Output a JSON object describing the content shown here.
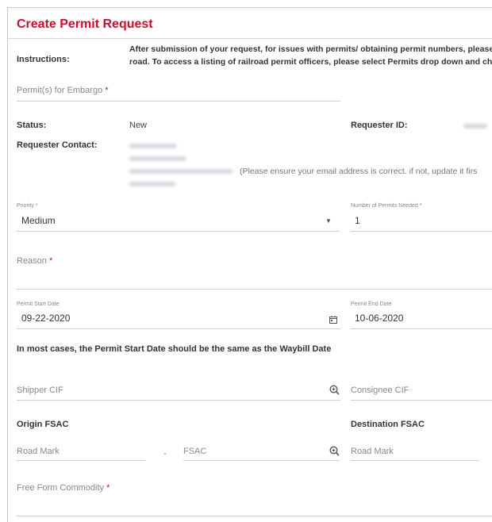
{
  "page": {
    "title": "Create Permit Request"
  },
  "instructions": {
    "label": "Instructions:",
    "line1": "After submission of your request, for issues with permits/ obtaining permit numbers, please",
    "line2": "road. To access a listing of railroad permit officers, please select Permits drop down and che"
  },
  "embargo": {
    "label": "Permit(s) for Embargo",
    "required": "*"
  },
  "status": {
    "label": "Status:",
    "value": "New",
    "requester_id_label": "Requester ID:"
  },
  "contact": {
    "label": "Requester Contact:",
    "email_hint": "(Please ensure your email address is correct. if not, update it firs"
  },
  "priority": {
    "label": "Priority *",
    "value": "Medium"
  },
  "permits_needed": {
    "label": "Number of Permits Needed *",
    "value": "1"
  },
  "reason": {
    "label": "Reason",
    "required": "*"
  },
  "start_date": {
    "label": "Permit Start Date",
    "value": "09-22-2020"
  },
  "end_date": {
    "label": "Permit End Date",
    "value": "10-06-2020"
  },
  "note": "In most cases, the Permit Start Date should be the same as the Waybill Date",
  "shipper": {
    "label": "Shipper CIF"
  },
  "consignee": {
    "label": "Consignee CIF"
  },
  "origin": {
    "heading": "Origin FSAC",
    "road_mark": "Road Mark",
    "fsac": "FSAC",
    "dash": "-"
  },
  "destination": {
    "heading": "Destination FSAC",
    "road_mark": "Road Mark"
  },
  "commodity": {
    "label": "Free Form Commodity",
    "required": "*"
  },
  "icons": {
    "dropdown": "caret-down-icon",
    "calendar": "calendar-icon",
    "search": "zoom-in-icon"
  },
  "colors": {
    "title": "#c8102e",
    "label": "#888888",
    "underline": "#cfcfcf"
  }
}
